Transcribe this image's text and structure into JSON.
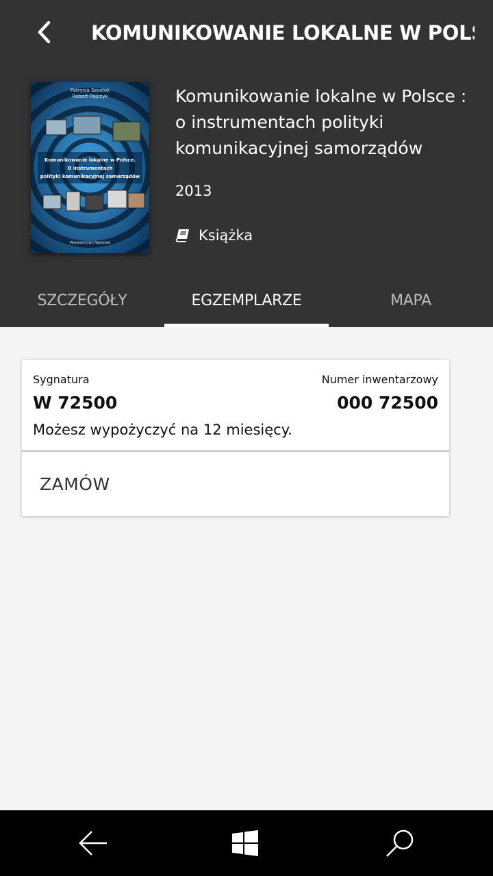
{
  "header": {
    "title": "KOMUNIKOWANIE LOKALNE W POLS...",
    "back_icon": "chevron-left-icon"
  },
  "book": {
    "title": "Komunikowanie lokalne w Polsce : o instrumentach polityki komunikacyjnej samorządów",
    "year": "2013",
    "type_icon": "book-icon",
    "type": "Książka",
    "cover": {
      "authors_line1": "Patrycja Szostok",
      "authors_line2": "Robert Rajczyk",
      "title_line1": "Komunikowanie lokalne w Polsce.",
      "title_line2": "O instrumentach",
      "title_line3": "polityki komunikacyjnej samorządów",
      "publisher": "Wydawnictwo Naukowe"
    }
  },
  "tabs": [
    {
      "label": "SZCZEGÓŁY",
      "active": false
    },
    {
      "label": "EGZEMPLARZE",
      "active": true
    },
    {
      "label": "MAPA",
      "active": false
    }
  ],
  "copy": {
    "signature_label": "Sygnatura",
    "signature_value": "W 72500",
    "inventory_label": "Numer inwentarzowy",
    "inventory_value": "000 72500",
    "loan_note": "Możesz wypożyczyć na 12 miesięcy.",
    "order_label": "ZAMÓW"
  },
  "navbar": {
    "back_icon": "back-arrow-icon",
    "home_icon": "windows-logo-icon",
    "search_icon": "search-icon"
  },
  "colors": {
    "header_bg": "#333333",
    "page_bg": "#f3f4f3",
    "navbar_bg": "#000000",
    "cover_blue": "#1a6fb3"
  }
}
